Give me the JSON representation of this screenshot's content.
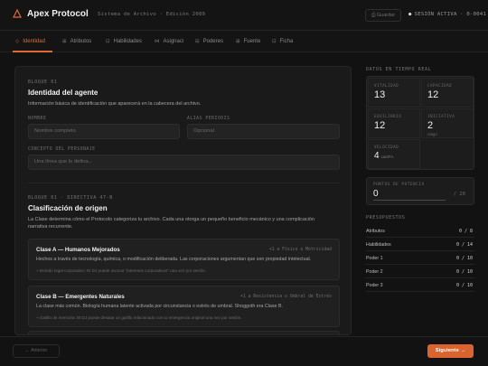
{
  "header": {
    "title": "Apex Protocol",
    "subtitle": "Sistema de Archivo · Edición 2089",
    "save_label": "Guardar",
    "session_label": "SESIÓN ACTIVA · 0-0041",
    "logo_icon": "triangle-logo-icon"
  },
  "tabs": [
    {
      "label": "Identidad",
      "icon": "◇",
      "active": true
    },
    {
      "label": "Atributos",
      "icon": "⊞",
      "active": false
    },
    {
      "label": "Habilidades",
      "icon": "⊡",
      "active": false
    },
    {
      "label": "Asignaci",
      "icon": "⋈",
      "active": false
    },
    {
      "label": "Poderes",
      "icon": "⊟",
      "active": false
    },
    {
      "label": "Fuente",
      "icon": "⊞",
      "active": false
    },
    {
      "label": "Ficha",
      "icon": "⊡",
      "active": false
    }
  ],
  "section1": {
    "label": "BLOQUE 01",
    "title": "Identidad del agente",
    "desc": "Información básica de identificación que aparecerá en la cabecera del archivo.",
    "fields": {
      "nombre_label": "NOMBRE",
      "nombre_placeholder": "Nombre completo",
      "alias_label": "ALIAS PERIODIS",
      "alias_placeholder": "Opcional",
      "concepto_label": "CONCEPTO DEL PERSONAJE",
      "concepto_placeholder": "Una línea que lo defina..."
    }
  },
  "section2": {
    "label": "BLOQUE 01 · DIRECTIVA 47-B",
    "title": "Clasificación de origen",
    "desc": "La Clase determina cómo el Protocolo categoriza tu archivo. Cada una otorga un pequeño beneficio mecánico y una complicación narrativa recurrente.",
    "cards": [
      {
        "title": "Clase A — Humanos Mejorados",
        "tag": "+1 a Físico o Motricidad",
        "desc": "Hechos a través de tecnología, química, o modificación deliberada. Las corporaciones argumentan que son propiedad intelectual.",
        "note": "+ Enredo legal corporativo: El DJ puede invocar \"intereses corporativos\" una vez por sesión."
      },
      {
        "title": "Clase B — Emergentes Naturales",
        "tag": "+1 a Resistencia o Umbral de Estrés",
        "desc": "La clase más común. Biología humana latente activada por circunstancia o estrés de umbral. Shoggoth era Clase B.",
        "note": "+ Gatillo de memoria: El DJ puede desatar un gatillo relacionado con tu emergencia original una vez por sesión."
      }
    ]
  },
  "right_panel": {
    "stats_label": "DATOS EN TIEMPO REAL",
    "stats": [
      {
        "label": "VITALIDAD",
        "value": "13"
      },
      {
        "label": "CAPACIDAD",
        "value": "12"
      },
      {
        "label": "EQUILIBRIO",
        "value": "12"
      },
      {
        "label": "INICIATIVA",
        "value": "2",
        "small": "rango"
      },
      {
        "label": "VELOCIDAD",
        "value": "4",
        "unit": "cas/FA"
      }
    ],
    "potencia": {
      "label": "PUNTOS DE POTENCIA",
      "value": "0",
      "max": "/ 20",
      "progress": 0
    },
    "budget_label": "PRESUPUESTOS",
    "budgets": [
      {
        "name": "Atributos",
        "value": "0 / 8"
      },
      {
        "name": "Habilidades",
        "value": "0 / 14"
      },
      {
        "name": "Poder 1",
        "value": "0 / 10"
      },
      {
        "name": "Poder 2",
        "value": "0 / 10"
      },
      {
        "name": "Poder 3",
        "value": "0 / 10"
      }
    ]
  },
  "footer": {
    "prev_label": "← Anterior",
    "next_label": "Siguiente →"
  },
  "colors": {
    "accent": "#e06a36",
    "background": "#121212",
    "panel": "#1a1a1a"
  }
}
